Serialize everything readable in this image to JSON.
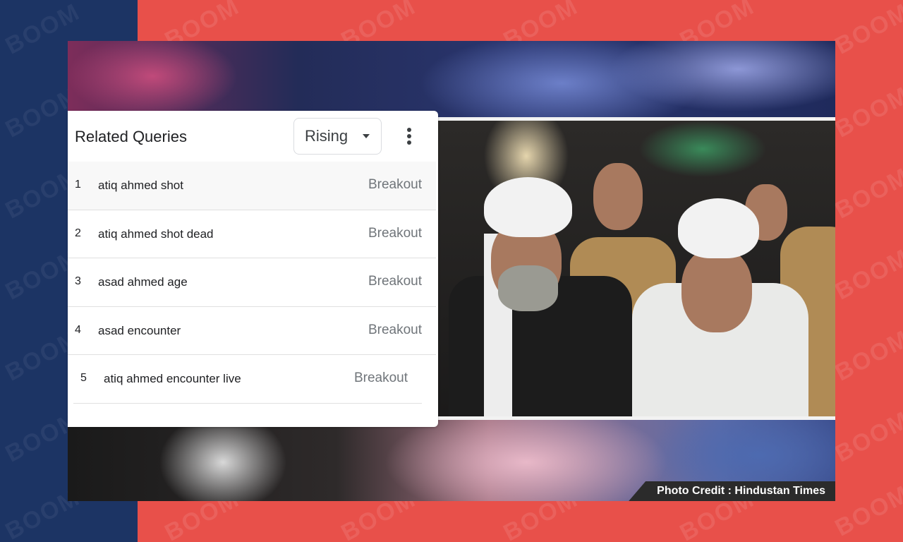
{
  "watermark": {
    "text": "BOOM"
  },
  "photo": {
    "credit": "Photo Credit : Hindustan Times"
  },
  "card": {
    "title": "Related Queries",
    "filter": {
      "selected": "Rising"
    },
    "menu_icon": "more-vert-icon",
    "rows": [
      {
        "rank": "1",
        "query": "atiq ahmed shot",
        "value": "Breakout"
      },
      {
        "rank": "2",
        "query": "atiq ahmed shot dead",
        "value": "Breakout"
      },
      {
        "rank": "3",
        "query": "asad ahmed age",
        "value": "Breakout"
      },
      {
        "rank": "4",
        "query": "asad encounter",
        "value": "Breakout"
      },
      {
        "rank": "5",
        "query": "atiq ahmed encounter live",
        "value": "Breakout"
      }
    ]
  },
  "colors": {
    "left_band": "#1c3464",
    "background": "#e8504a",
    "card": "#ffffff",
    "value_text": "#70757a"
  }
}
